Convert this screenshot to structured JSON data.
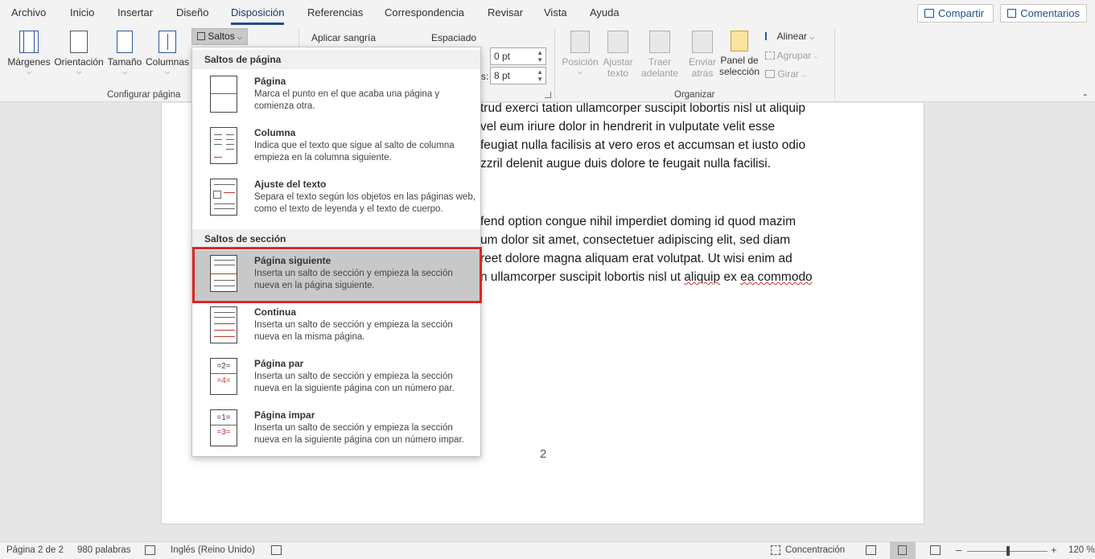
{
  "tabs": [
    "Archivo",
    "Inicio",
    "Insertar",
    "Diseño",
    "Disposición",
    "Referencias",
    "Correspondencia",
    "Revisar",
    "Vista",
    "Ayuda"
  ],
  "active_tab": "Disposición",
  "top_buttons": {
    "share": "Compartir",
    "comments": "Comentarios"
  },
  "ribbon": {
    "page_setup": {
      "margins": "Márgenes",
      "orientation": "Orientación",
      "size": "Tamaño",
      "columns": "Columnas",
      "breaks": "Saltos",
      "group_label": "Configurar página"
    },
    "paragraph": {
      "indent": "Aplicar sangría",
      "spacing": "Espaciado",
      "spacing_before": "0 pt",
      "spacing_after_label": "s:",
      "spacing_after": "8 pt"
    },
    "arrange": {
      "position": [
        "Posición"
      ],
      "wrap_1": "Ajustar",
      "wrap_2": "texto",
      "forward_1": "Traer",
      "forward_2": "adelante",
      "backward_1": "Enviar",
      "backward_2": "atrás",
      "pane_1": "Panel de",
      "pane_2": "selección",
      "align": "Alinear",
      "group": "Agrupar",
      "rotate": "Girar",
      "group_label": "Organizar"
    }
  },
  "document": {
    "lines": [
      "trud exerci tation ullamcorper suscipit lobortis nisl ut aliquip",
      "vel eum iriure dolor in hendrerit in vulputate velit esse",
      "feugiat nulla facilisis at vero eros et accumsan et iusto odio",
      "zzril delenit augue duis dolore te feugait nulla facilisi.",
      "fend option congue nihil imperdiet doming id quod mazim",
      "um dolor sit amet, consectetuer adipiscing elit, sed diam",
      "reet dolore magna aliquam erat volutpat. Ut wisi enim ad"
    ],
    "last_line_start": "n ullamcorper suscipit lobortis nisl ut ",
    "last_line_word1": "aliquip",
    "last_line_mid": " ex ",
    "last_line_word2": "ea commodo",
    "page_number": "2"
  },
  "breaks_menu": {
    "page_breaks_header": "Saltos de página",
    "section_breaks_header": "Saltos de sección",
    "items": [
      {
        "title": "Página",
        "desc": "Marca el punto en el que acaba una página y comienza otra."
      },
      {
        "title": "Columna",
        "desc": "Indica que el texto que sigue al salto de columna empieza en la columna siguiente."
      },
      {
        "title": "Ajuste del texto",
        "desc": "Separa el texto según los objetos en las páginas web, como el texto de leyenda y el texto de cuerpo."
      },
      {
        "title": "Página siguiente",
        "desc": "Inserta un salto de sección y empieza la sección nueva en la página siguiente."
      },
      {
        "title": "Continua",
        "desc": "Inserta un salto de sección y empieza la sección nueva en la misma página."
      },
      {
        "title": "Página par",
        "desc": "Inserta un salto de sección y empieza la sección nueva en la siguiente página con un número par."
      },
      {
        "title": "Página impar",
        "desc": "Inserta un salto de sección y empieza la sección nueva en la siguiente página con un número impar."
      }
    ],
    "selected": "Página siguiente"
  },
  "status": {
    "page": "Página 2 de 2",
    "words": "980 palabras",
    "language": "Inglés (Reino Unido)",
    "focus": "Concentración",
    "zoom": "120 %"
  },
  "colors": {
    "accent": "#1e4e8c",
    "highlight": "#e02424",
    "selected_bg": "#c8c8c8"
  }
}
